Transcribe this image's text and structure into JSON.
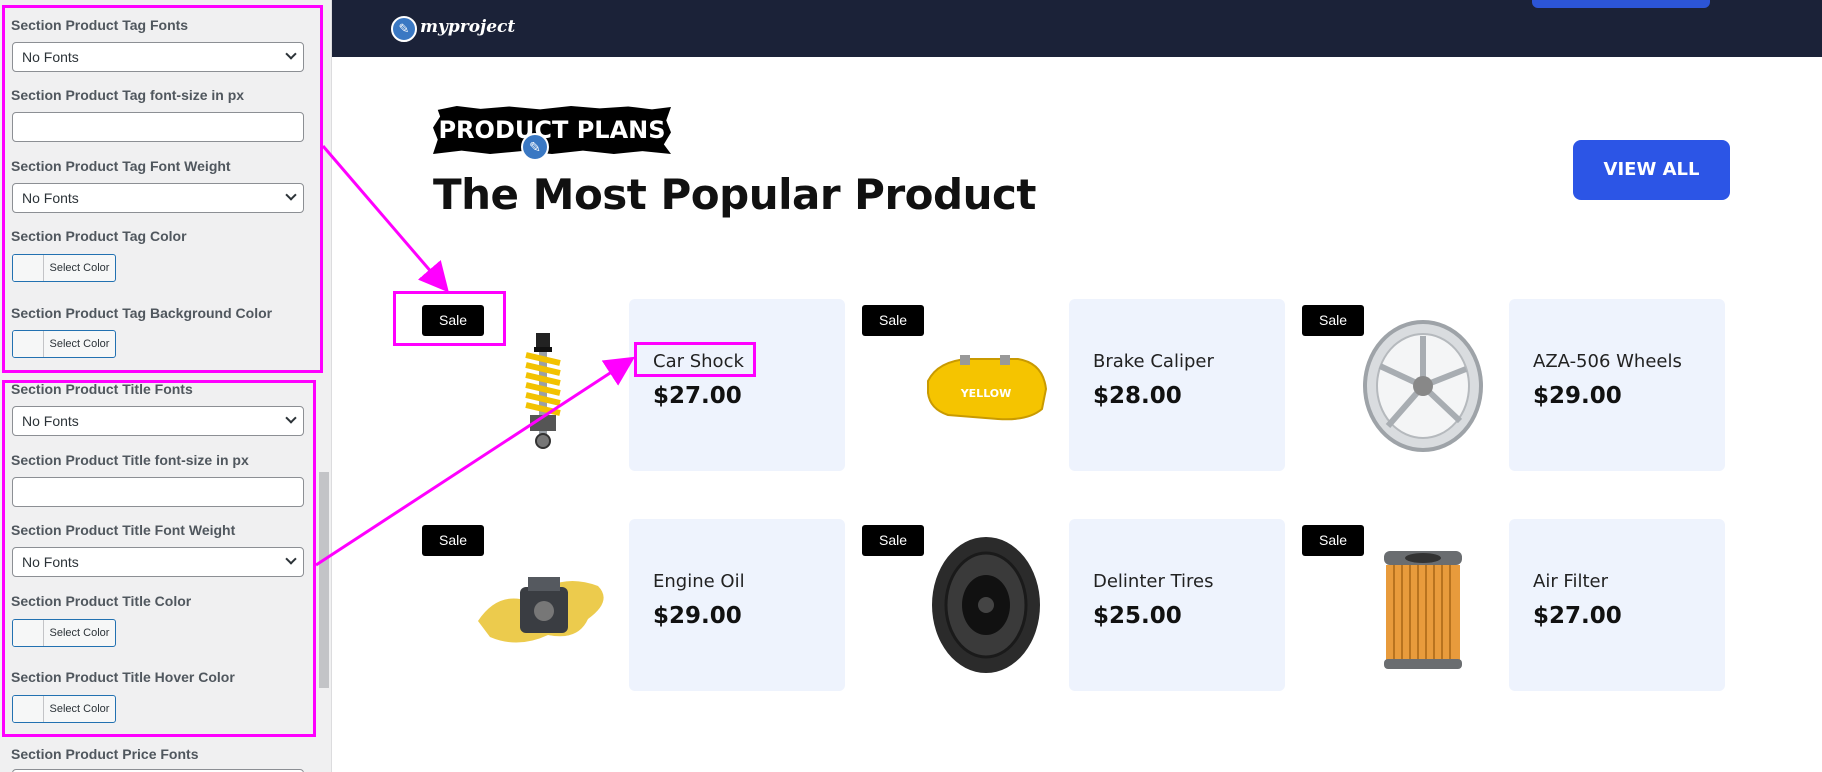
{
  "customizer": {
    "fields": [
      {
        "label": "Section Product Tag Fonts",
        "type": "select",
        "value": "No Fonts"
      },
      {
        "label": "Section Product Tag font-size in px",
        "type": "input",
        "value": ""
      },
      {
        "label": "Section Product Tag Font Weight",
        "type": "select",
        "value": "No Fonts"
      },
      {
        "label": "Section Product Tag Color",
        "type": "color",
        "button": "Select Color"
      },
      {
        "label": "Section Product Tag Background Color",
        "type": "color",
        "button": "Select Color"
      },
      {
        "label": "Section Product Title Fonts",
        "type": "select",
        "value": "No Fonts"
      },
      {
        "label": "Section Product Title font-size in px",
        "type": "input",
        "value": ""
      },
      {
        "label": "Section Product Title Font Weight",
        "type": "select",
        "value": "No Fonts"
      },
      {
        "label": "Section Product Title Color",
        "type": "color",
        "button": "Select Color"
      },
      {
        "label": "Section Product Title Hover Color",
        "type": "color",
        "button": "Select Color"
      },
      {
        "label": "Section Product Price Fonts",
        "type": "label"
      }
    ]
  },
  "site": {
    "logo_text": "myproject",
    "logo_icon": "pencil-icon"
  },
  "section": {
    "tag": "PRODUCT PLANS",
    "title": "The Most Popular Product",
    "view_all": "VIEW ALL"
  },
  "products": [
    {
      "sale": "Sale",
      "title": "Car Shock",
      "price": "$27.00",
      "icon": "car-shock-image"
    },
    {
      "sale": "Sale",
      "title": "Brake Caliper",
      "price": "$28.00",
      "icon": "brake-caliper-image",
      "caliper_text": "YELLOW"
    },
    {
      "sale": "Sale",
      "title": "AZA-506 Wheels",
      "price": "$29.00",
      "icon": "wheel-image"
    },
    {
      "sale": "Sale",
      "title": "Engine Oil",
      "price": "$29.00",
      "icon": "engine-oil-image"
    },
    {
      "sale": "Sale",
      "title": "Delinter Tires",
      "price": "$25.00",
      "icon": "tire-image"
    },
    {
      "sale": "Sale",
      "title": "Air Filter",
      "price": "$27.00",
      "icon": "air-filter-image"
    }
  ],
  "colors": {
    "header_bg": "#1b2238",
    "accent": "#2c55e6",
    "annotation": "#ff00ff",
    "card_bg": "#eef3fd"
  }
}
